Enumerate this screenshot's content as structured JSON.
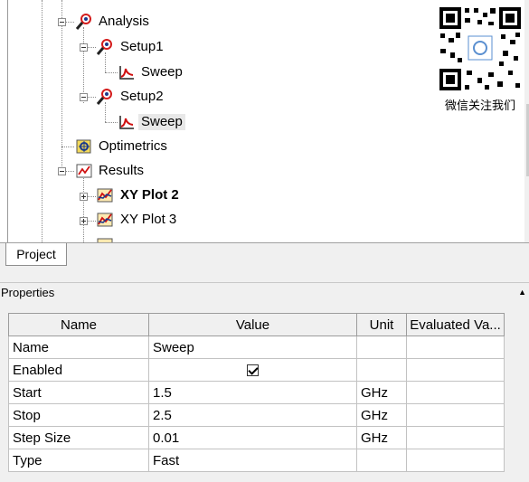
{
  "tree": {
    "items": [
      {
        "label": "Analysis",
        "icon": "analysis-icon"
      },
      {
        "label": "Setup1",
        "icon": "setup-icon"
      },
      {
        "label": "Sweep",
        "icon": "sweep-icon"
      },
      {
        "label": "Setup2",
        "icon": "setup-icon"
      },
      {
        "label": "Sweep",
        "icon": "sweep-icon",
        "selected": true
      },
      {
        "label": "Optimetrics",
        "icon": "optimetrics-icon"
      },
      {
        "label": "Results",
        "icon": "results-icon"
      },
      {
        "label": "XY Plot 2",
        "icon": "xy-plot-icon",
        "bold": true
      },
      {
        "label": "XY Plot 3",
        "icon": "xy-plot-icon"
      }
    ]
  },
  "qr": {
    "caption": "微信关注我们"
  },
  "tabs": {
    "project": "Project"
  },
  "properties": {
    "title": "Properties",
    "columns": [
      "Name",
      "Value",
      "Unit",
      "Evaluated Va..."
    ],
    "rows": [
      {
        "name": "Name",
        "value": "Sweep",
        "unit": "",
        "evaluated": ""
      },
      {
        "name": "Enabled",
        "value": "",
        "checked": true,
        "unit": "",
        "evaluated": ""
      },
      {
        "name": "Start",
        "value": "1.5",
        "unit": "GHz",
        "evaluated": ""
      },
      {
        "name": "Stop",
        "value": "2.5",
        "unit": "GHz",
        "evaluated": ""
      },
      {
        "name": "Step Size",
        "value": "0.01",
        "unit": "GHz",
        "evaluated": ""
      },
      {
        "name": "Type",
        "value": "Fast",
        "unit": "",
        "evaluated": ""
      }
    ]
  },
  "colors": {
    "sweep_curve": "#d01010",
    "selection": "#e8e8e8",
    "panel_bg": "#f0f0f0"
  }
}
